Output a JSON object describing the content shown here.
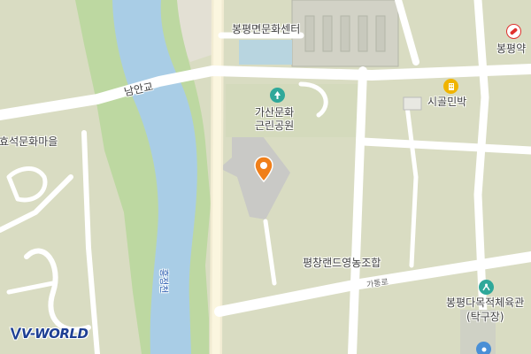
{
  "map": {
    "labels": {
      "center": "봉평면문화센터",
      "pharmacy": "봉평약",
      "bridge": "남안교",
      "park_line1": "가산문화",
      "park_line2": "근린공원",
      "minbak": "시골민박",
      "village": "이효석문화마을",
      "river": "흥정천",
      "farm": "평창랜드영농조합",
      "road": "가통로",
      "sports_line1": "봉평다목적체육관",
      "sports_line2": "(탁구장)"
    },
    "icons": {
      "park": "tree-icon",
      "pharmacy": "pill-icon",
      "minbak": "building-icon",
      "sports": "sports-icon",
      "marker": "location-pin-icon"
    },
    "colors": {
      "land": "#d9dcc2",
      "water": "#a9cde6",
      "river_bank": "#bdd8a1",
      "road": "#ffffff",
      "marker": "#f07f1a",
      "park_icon": "#2fa89a",
      "pharmacy_icon": "#e0312d",
      "minbak_icon": "#f0b400"
    },
    "logo": "V-WORLD"
  }
}
